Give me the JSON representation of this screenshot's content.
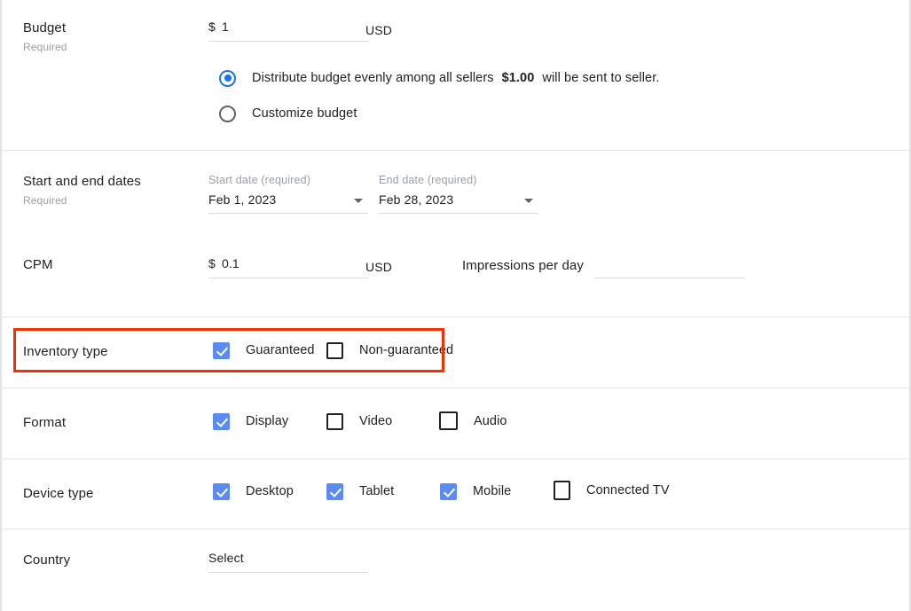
{
  "sections": {
    "budget": {
      "label": "Budget",
      "sublabel": "Required",
      "currency_prefix": "$",
      "amount": "1",
      "unit": "USD",
      "options": [
        {
          "label": "Distribute budget evenly among all sellers",
          "amount": "$1.00",
          "tail": "will be sent to seller.",
          "selected": true
        },
        {
          "label": "Customize budget",
          "selected": false
        }
      ]
    },
    "dates": {
      "label": "Start and end dates",
      "sublabel": "Required",
      "start": {
        "float_label": "Start date (required)",
        "value": "Feb 1, 2023"
      },
      "end": {
        "float_label": "End date (required)",
        "value": "Feb 28, 2023"
      }
    },
    "cpm": {
      "label": "CPM",
      "currency_prefix": "$",
      "amount": "0.1",
      "unit": "USD",
      "impressions_label": "Impressions per day",
      "impressions_value": ""
    },
    "inventory_type": {
      "label": "Inventory type",
      "highlighted": true,
      "options": [
        {
          "label": "Guaranteed",
          "checked": true
        },
        {
          "label": "Non-guaranteed",
          "checked": false
        }
      ]
    },
    "format": {
      "label": "Format",
      "options": [
        {
          "label": "Display",
          "checked": true
        },
        {
          "label": "Video",
          "checked": false
        },
        {
          "label": "Audio",
          "checked": false
        }
      ]
    },
    "device_type": {
      "label": "Device type",
      "options": [
        {
          "label": "Desktop",
          "checked": true
        },
        {
          "label": "Tablet",
          "checked": true
        },
        {
          "label": "Mobile",
          "checked": true
        },
        {
          "label": "Connected TV",
          "checked": false
        }
      ]
    },
    "country": {
      "label": "Country",
      "value": "Select"
    }
  },
  "colors": {
    "accent_blue": "#1a73e8",
    "checkbox_blue": "#5b8bf0",
    "highlight_red": "#f23005",
    "divider": "#e4e5e6",
    "muted_text": "#9aa0a6"
  }
}
